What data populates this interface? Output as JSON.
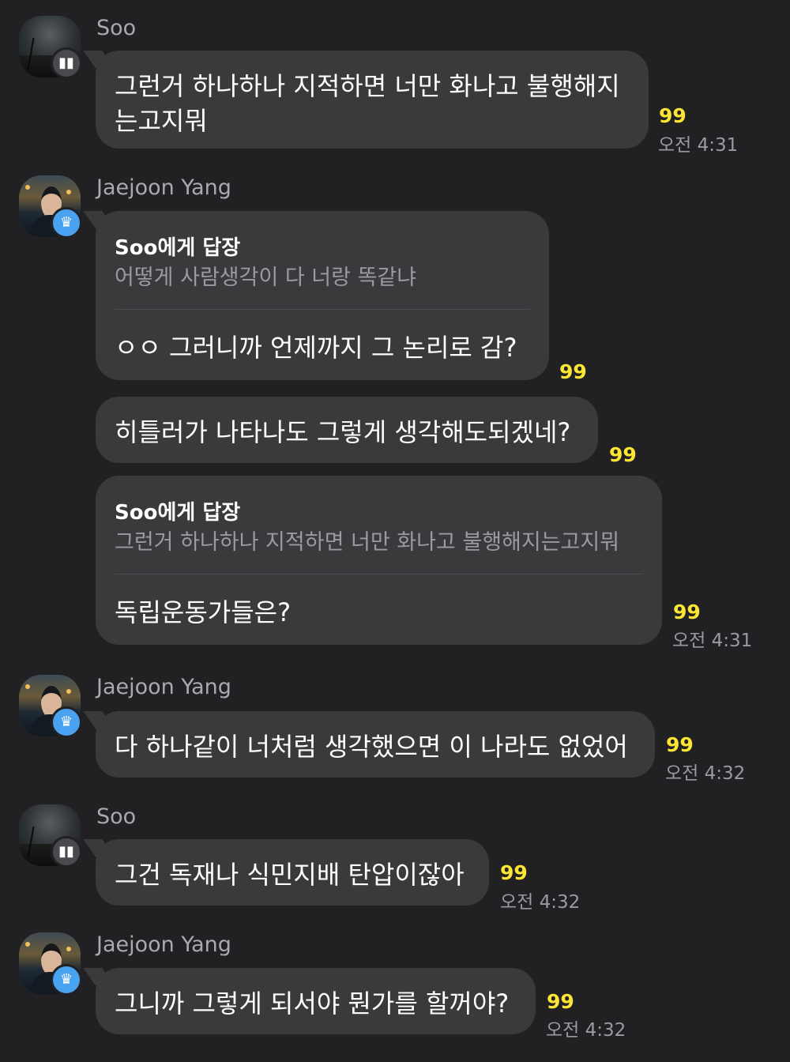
{
  "colors": {
    "background": "#212123",
    "bubble": "#3a3a3c",
    "unread": "#fde533",
    "badge_blue": "#4aa3f0"
  },
  "messages": [
    {
      "sender": "Soo",
      "text_line1": "그런거 하나하나 지적하면 너만 화나고 불행해지",
      "text_line2": "는고지뭐",
      "unread": "99",
      "time": "오전 4:31"
    },
    {
      "sender": "Jaejoon Yang",
      "reply_to": "Soo에게 답장",
      "quote": "어떻게 사람생각이 다 너랑 똑같냐",
      "text": "ㅇㅇ 그러니까 언제까지 그  논리로 감?",
      "unread": "99"
    },
    {
      "text": "히틀러가 나타나도 그렇게 생각해도되겠네?",
      "unread": "99"
    },
    {
      "reply_to": "Soo에게 답장",
      "quote": "그런거 하나하나 지적하면 너만 화나고 불행해지는고지뭐",
      "text": "독립운동가들은?",
      "unread": "99",
      "time": "오전 4:31"
    },
    {
      "sender": "Jaejoon Yang",
      "text": "다 하나같이 너처럼 생각했으면 이 나라도 없었어",
      "unread": "99",
      "time": "오전 4:32"
    },
    {
      "sender": "Soo",
      "text": "그건 독재나 식민지배 탄압이잖아",
      "unread": "99",
      "time": "오전 4:32"
    },
    {
      "sender": "Jaejoon Yang",
      "text": "그니까 그렇게 되서야 뭔가를 할꺼야?",
      "unread": "99",
      "time": "오전 4:32"
    }
  ]
}
